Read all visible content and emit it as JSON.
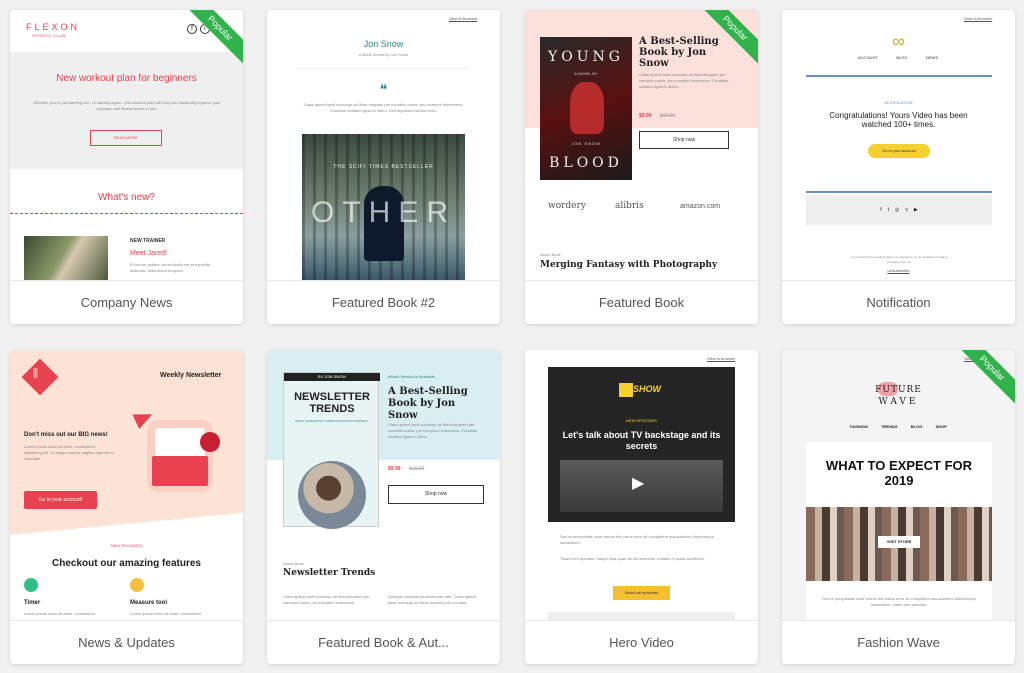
{
  "badge": "Popular",
  "cards": {
    "company": {
      "title": "Company News",
      "brand": "FLEXON",
      "brand_sub": "SPORTS CLUB",
      "headline": "New workout plan for beginners",
      "intro": "Whether you're just starting out - or starting again - this workout plan will help you drastically improve your physique and fitness levels in four.",
      "button": "READ MORE",
      "whats_new": "What's new?",
      "trainer_label": "NEW TRAINER",
      "trainer_name": "Meet Jared!",
      "trainer_text": "Et harum quidem rerum facilis est et expedita distinctio. Nam libero tempore."
    },
    "featured2": {
      "title": "Featured Book #2",
      "top_link": "View in browser",
      "author": "Jon Snow",
      "author_sub": "A Book Series by Jon Snow",
      "quote": "Class aptent taciti sociosqu ad litora torquent per conubia nostra, per inceptos himenaeos. Curabitur sodales ligula in libero. Sed dignissim lacinia nunc.",
      "cover_tag": "THE SCIFI TIMES BESTSELLER",
      "cover_title": "OTHER"
    },
    "featured": {
      "title": "Featured Book",
      "cover_title_1": "YOUNG",
      "cover_title_2": "BLOOD",
      "cover_sub": "A NOVEL BY",
      "cover_author": "JON SNOW",
      "headline": "A Best-Selling Book by Jon Snow",
      "desc": "Class aptent taciti sociosqu ad litora torquent per conubia nostra, per inceptos himenaeos. Curabitur sodales ligula in libero.",
      "price": "$9.99",
      "old_price": "$16.99",
      "button": "Shop now",
      "stores": [
        "wordery",
        "alibris",
        "amazon.com"
      ],
      "about": "About Book",
      "about_title": "Merging Fantasy with Photography"
    },
    "notification": {
      "title": "Notification",
      "top_link": "View in browser",
      "nav": [
        "ACCOUNT",
        "BLOG",
        "NEWS"
      ],
      "label": "NOTIFICATION",
      "headline": "Congratulations! Yours Video has been watched 100+ times.",
      "button": "Go to your account",
      "footer": "You received this email because you signed up on our website or made a purchase from us.",
      "unsubscribe": "Unsubscribe"
    },
    "news": {
      "title": "News & Updates",
      "heading": "Weekly Newsletter",
      "lead": "Don't miss out our BIG news!",
      "lead_text": "Lorem ipsum dolor sit amet, consectetur adipiscing elit. Ut augue mauris, sagittis eget elit et vulputate.",
      "button": "Go to your account!",
      "releases": "NEW RELEASES",
      "features": "Checkout our amazing features",
      "feature_a": "Timer",
      "feature_b": "Measure tool",
      "feature_text": "Lorem ipsum dolor sit amet, consectetur"
    },
    "featured_author": {
      "title": "Featured Book & Aut...",
      "cover_author": "BY JON SNOW",
      "cover_title": "NEWSLETTER TRENDS",
      "cover_sub": "EMAIL MARKETING COMMUNICATIONS STRATEGY",
      "tag": "eBook Version is Available",
      "headline": "A Best-Selling Book by Jon Snow",
      "desc": "Class aptent taciti sociosqu ad litora torquent per conubia nostra, per inceptos himenaeos. Curabitur sodales ligula in libero.",
      "price": "$9.99",
      "old_price": "$16.99",
      "button": "Shop now",
      "about": "About Book",
      "about_title": "Newsletter Trends",
      "col_a": "Class aptent taciti sociosqu ad litora torquent per conubia nostra, per inceptos himenaeos.",
      "col_b": "Quisque volutpat condimentum velit. Class aptent taciti sociosqu ad litora torquent per conubia."
    },
    "hero": {
      "title": "Hero Video",
      "top_link": "View in browser",
      "logo": "SHOW",
      "label": "NEW EPISODES",
      "headline": "Let's talk about TV backstage and its secrets",
      "text1": "Sed ut perspiciatis unde omnis iste natus error sit voluptatem accusantium doloremque laudantium.",
      "text2": "Totam rem aperiam, eaque ipsa quae ab illo inventore veritatis et quasi architecto.",
      "button": "Watch all episodes"
    },
    "fashion": {
      "title": "Fashion Wave",
      "top_link": "View in browser",
      "logo_1": "FUTURE",
      "logo_2": "WAVE",
      "nav": [
        "FASHION",
        "TRENDS",
        "BLOG",
        "SHOP"
      ],
      "headline": "WHAT TO EXPECT FOR 2019",
      "button": "VISIT STORE",
      "text": "Sed ut perspiciatis unde omnis iste natus error sit voluptatem accusantium doloremque laudantium, totam rem aperiam."
    }
  },
  "colors": {
    "red": "#e8414f",
    "green": "#2fb34a",
    "yellow": "#f5d030",
    "blue": "#6b8fc7",
    "teal": "#2a8a8a",
    "pink_bg": "#fbe0dc",
    "peach_bg": "#fde3d5"
  },
  "icons": [
    "facebook-icon",
    "twitter-icon",
    "quote-icon",
    "play-icon",
    "infinity-logo-icon",
    "instagram-icon",
    "vimeo-icon",
    "youtube-icon",
    "stopwatch-icon",
    "ruler-icon"
  ]
}
